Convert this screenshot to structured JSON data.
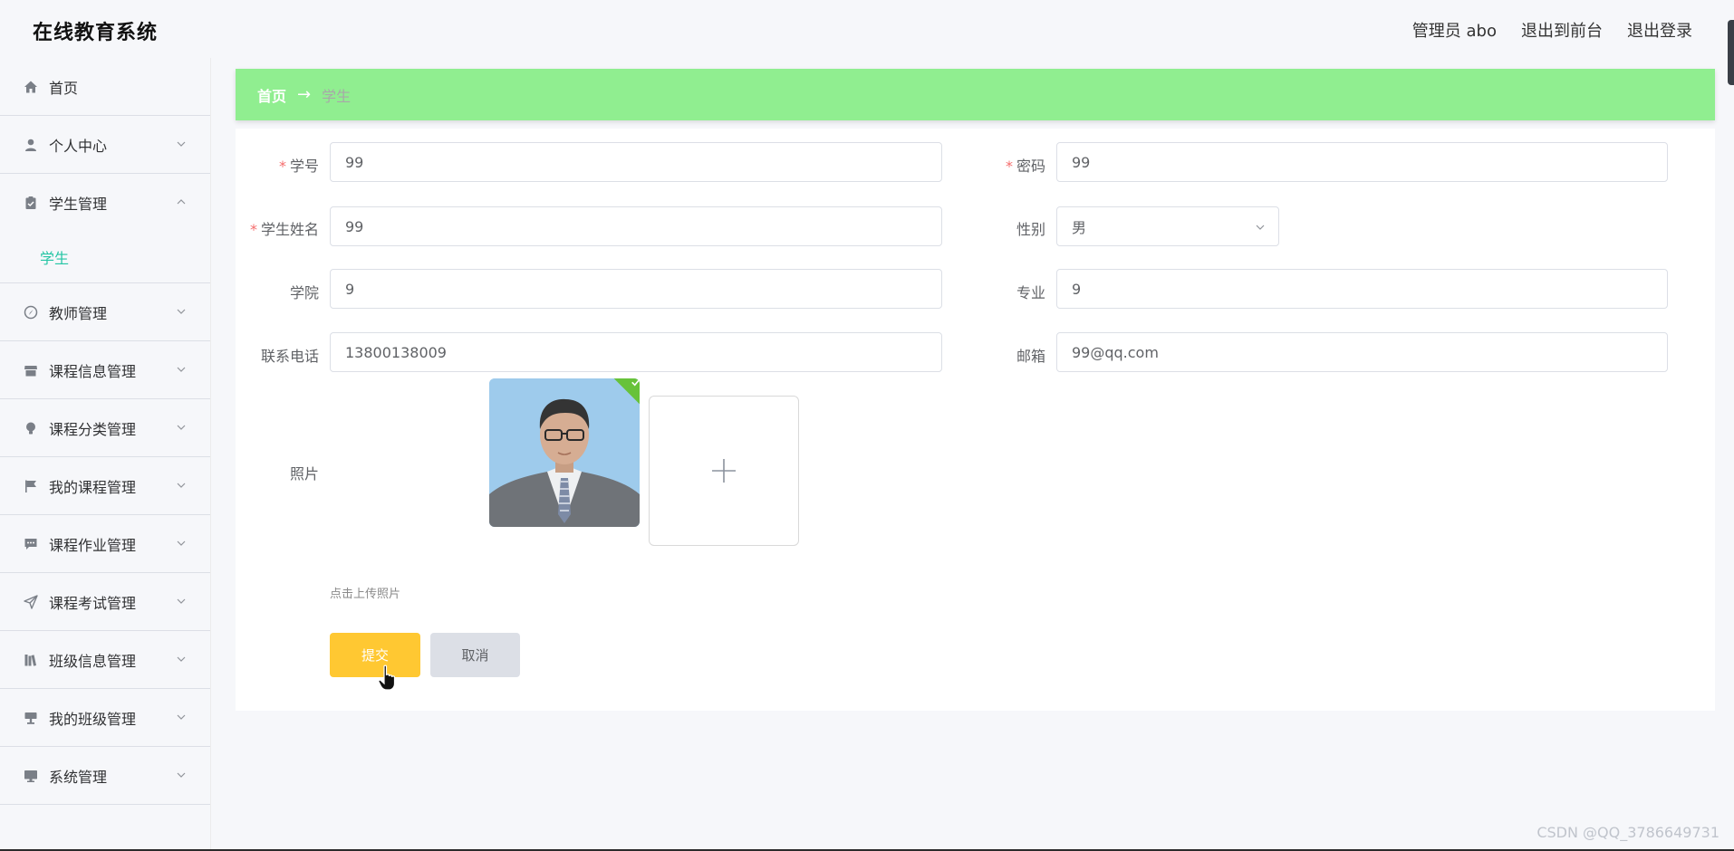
{
  "app": {
    "title": "在线教育系统"
  },
  "header": {
    "user": "管理员 abo",
    "to_front": "退出到前台",
    "logout": "退出登录"
  },
  "sidebar": {
    "items": [
      {
        "label": "首页",
        "icon": "home-icon",
        "has_arrow": false
      },
      {
        "label": "个人中心",
        "icon": "user-icon",
        "has_arrow": true
      },
      {
        "label": "学生管理",
        "icon": "clipboard-icon",
        "has_arrow": true,
        "open": true,
        "sub": [
          "学生"
        ]
      },
      {
        "label": "教师管理",
        "icon": "compass-icon",
        "has_arrow": true
      },
      {
        "label": "课程信息管理",
        "icon": "shop-icon",
        "has_arrow": true
      },
      {
        "label": "课程分类管理",
        "icon": "bulb-icon",
        "has_arrow": true
      },
      {
        "label": "我的课程管理",
        "icon": "flag-icon",
        "has_arrow": true
      },
      {
        "label": "课程作业管理",
        "icon": "chat-icon",
        "has_arrow": true
      },
      {
        "label": "课程考试管理",
        "icon": "send-icon",
        "has_arrow": true
      },
      {
        "label": "班级信息管理",
        "icon": "books-icon",
        "has_arrow": true
      },
      {
        "label": "我的班级管理",
        "icon": "podium-icon",
        "has_arrow": true
      },
      {
        "label": "系统管理",
        "icon": "monitor-icon",
        "has_arrow": true
      }
    ]
  },
  "breadcrumb": {
    "home": "首页",
    "arrow": "→",
    "current": "学生"
  },
  "form": {
    "student_id": {
      "label": "学号",
      "value": "99",
      "required": true
    },
    "password": {
      "label": "密码",
      "value": "99",
      "required": true
    },
    "student_name": {
      "label": "学生姓名",
      "value": "99",
      "required": true
    },
    "gender": {
      "label": "性别",
      "value": "男"
    },
    "college": {
      "label": "学院",
      "value": "9"
    },
    "major": {
      "label": "专业",
      "value": "9"
    },
    "phone": {
      "label": "联系电话",
      "value": "13800138009"
    },
    "email": {
      "label": "邮箱",
      "value": "99@qq.com"
    },
    "photo": {
      "label": "照片",
      "tip": "点击上传照片"
    }
  },
  "buttons": {
    "submit": "提交",
    "cancel": "取消"
  },
  "watermark": "CSDN @QQ_3786649731",
  "colors": {
    "accent": "#24c5a4",
    "breadcrumb_bg": "#90ee90",
    "submit": "#ffc832",
    "required": "#f56c6c"
  }
}
